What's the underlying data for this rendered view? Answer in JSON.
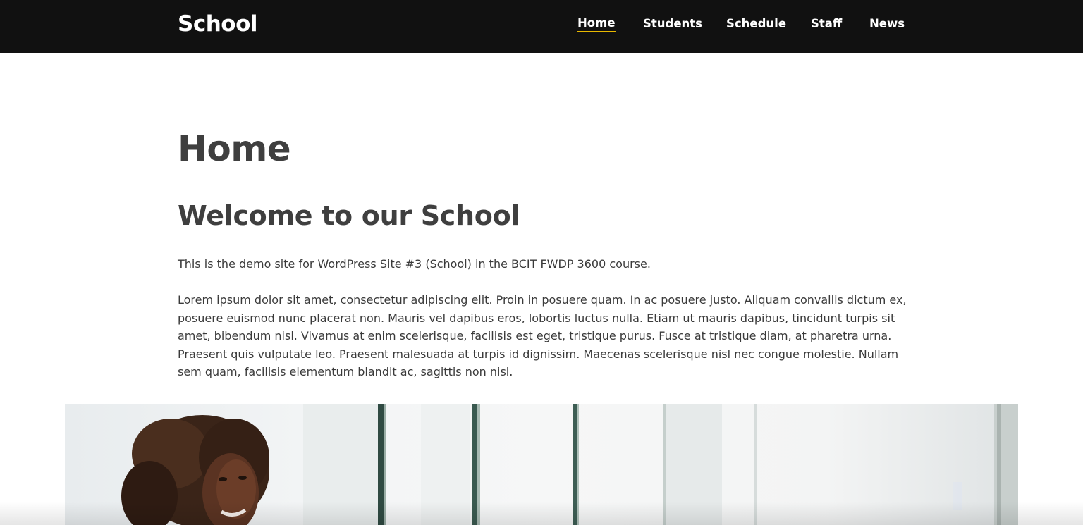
{
  "header": {
    "site_title": "School",
    "nav": [
      {
        "label": "Home",
        "active": true
      },
      {
        "label": "Students",
        "active": false
      },
      {
        "label": "Schedule",
        "active": false
      },
      {
        "label": "Staff",
        "active": false
      },
      {
        "label": "News",
        "active": false
      }
    ],
    "active_underline_color": "#e8b800",
    "background_color": "#111111"
  },
  "main": {
    "page_title": "Home",
    "welcome_heading": "Welcome to our School",
    "intro": "This is the demo site for WordPress Site #3 (School) in the BCIT FWDP 3600 course.",
    "lorem_lines": [
      "Lorem ipsum dolor sit amet, consectetur adipiscing elit. Proin in posuere quam. In ac posuere justo. Aliquam convallis dictum ex,",
      "posuere euismod nunc placerat non. Mauris vel dapibus eros, lobortis luctus nulla. Etiam ut mauris dapibus, tincidunt turpis sit",
      "amet, bibendum nisl. Vivamus at enim scelerisque, facilisis est eget, tristique purus. Fusce at tristique diam, at pharetra urna.",
      "Praesent quis vulputate leo. Praesent malesuada at turpis id dignissim. Maecenas scelerisque nisl nec congue molestie. Nullam",
      "sem quam, facilisis elementum blandit ac, sagittis non nisl."
    ]
  }
}
